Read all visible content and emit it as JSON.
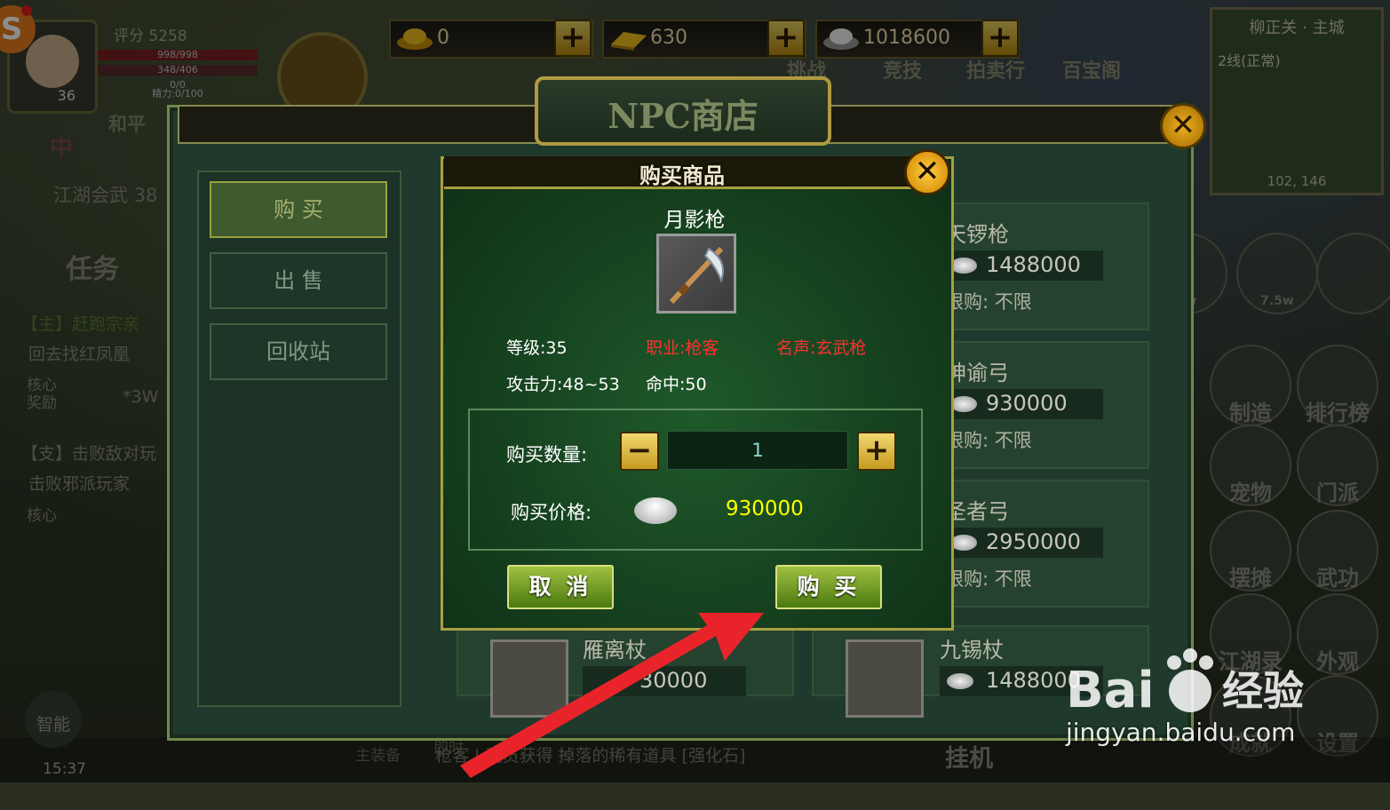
{
  "hud": {
    "logo_text": "S",
    "level": "36",
    "score": "评分 5258",
    "hp": "998/998",
    "mp": "348/406",
    "exp": "0/0",
    "energy": "精力:0/100",
    "pk_mode": "和平",
    "resources": [
      {
        "icon": "gold-ingot-icon",
        "value": "0"
      },
      {
        "icon": "gold-bar-icon",
        "value": "630"
      },
      {
        "icon": "silver-ingot-icon",
        "value": "1018600"
      }
    ],
    "nav": [
      "挑战",
      "竞技",
      "拍卖行",
      "百宝阁"
    ]
  },
  "minimap": {
    "title": "柳正关 · 主城",
    "line": "2线(正常)",
    "coords": "102, 146"
  },
  "left_panel": {
    "event": "江湖会武",
    "event_num": "38",
    "task_tab": "任务",
    "tab_zhong": "中",
    "quests": [
      {
        "tag": "【主】赶跑宗亲",
        "desc": "回去找红凤凰",
        "reward_label": "核心\n奖励",
        "reward": "*3W"
      },
      {
        "tag": "【支】击败敌对玩",
        "desc": "击败邪派玩家",
        "reward_label": "核心"
      }
    ]
  },
  "right_buttons": [
    "7w",
    "7.5w",
    "制造",
    "排行榜",
    "宠物",
    "门派",
    "摆摊",
    "武功",
    "江湖录",
    "外观",
    "成就",
    "设置"
  ],
  "bottom": {
    "smart": "智能",
    "time": "15:37",
    "equip": "主装备",
    "chat_tab": "即时",
    "ticker": "枪客 | 龍员获得 掉落的稀有道具 [强化石]",
    "hangup": "挂机"
  },
  "shop": {
    "title": "NPC商店",
    "tabs": [
      "购 买",
      "出 售",
      "回收站"
    ],
    "items": [
      {
        "name": "天锣枪",
        "price": "1488000",
        "limit": "限购: 不限"
      },
      {
        "name": "神谕弓",
        "price": "930000",
        "limit": "限购: 不限"
      },
      {
        "name": "圣者弓",
        "price": "2950000",
        "limit": "限购: 不限"
      },
      {
        "name": "雁离杖",
        "price": "30000"
      },
      {
        "name": "九锡杖",
        "price": "1488000"
      }
    ]
  },
  "dialog": {
    "title": "购买商品",
    "item_name": "月影枪",
    "item_icon": "spear-icon",
    "level": "等级:35",
    "profession": "职业:枪客",
    "fame": "名声:玄武枪",
    "attack": "攻击力:48~53",
    "hit": "命中:50",
    "qty_label": "购买数量:",
    "qty_value": "1",
    "price_label": "购买价格:",
    "price_value": "930000",
    "cancel": "取 消",
    "buy": "购 买"
  },
  "colors": {
    "accent_gold": "#a8a040",
    "price_yellow": "#ffff00",
    "stat_red": "#ff3030",
    "arrow_red": "#e8242a"
  },
  "watermark": {
    "brand": "Bai经验",
    "url": "jingyan.baidu.com"
  }
}
